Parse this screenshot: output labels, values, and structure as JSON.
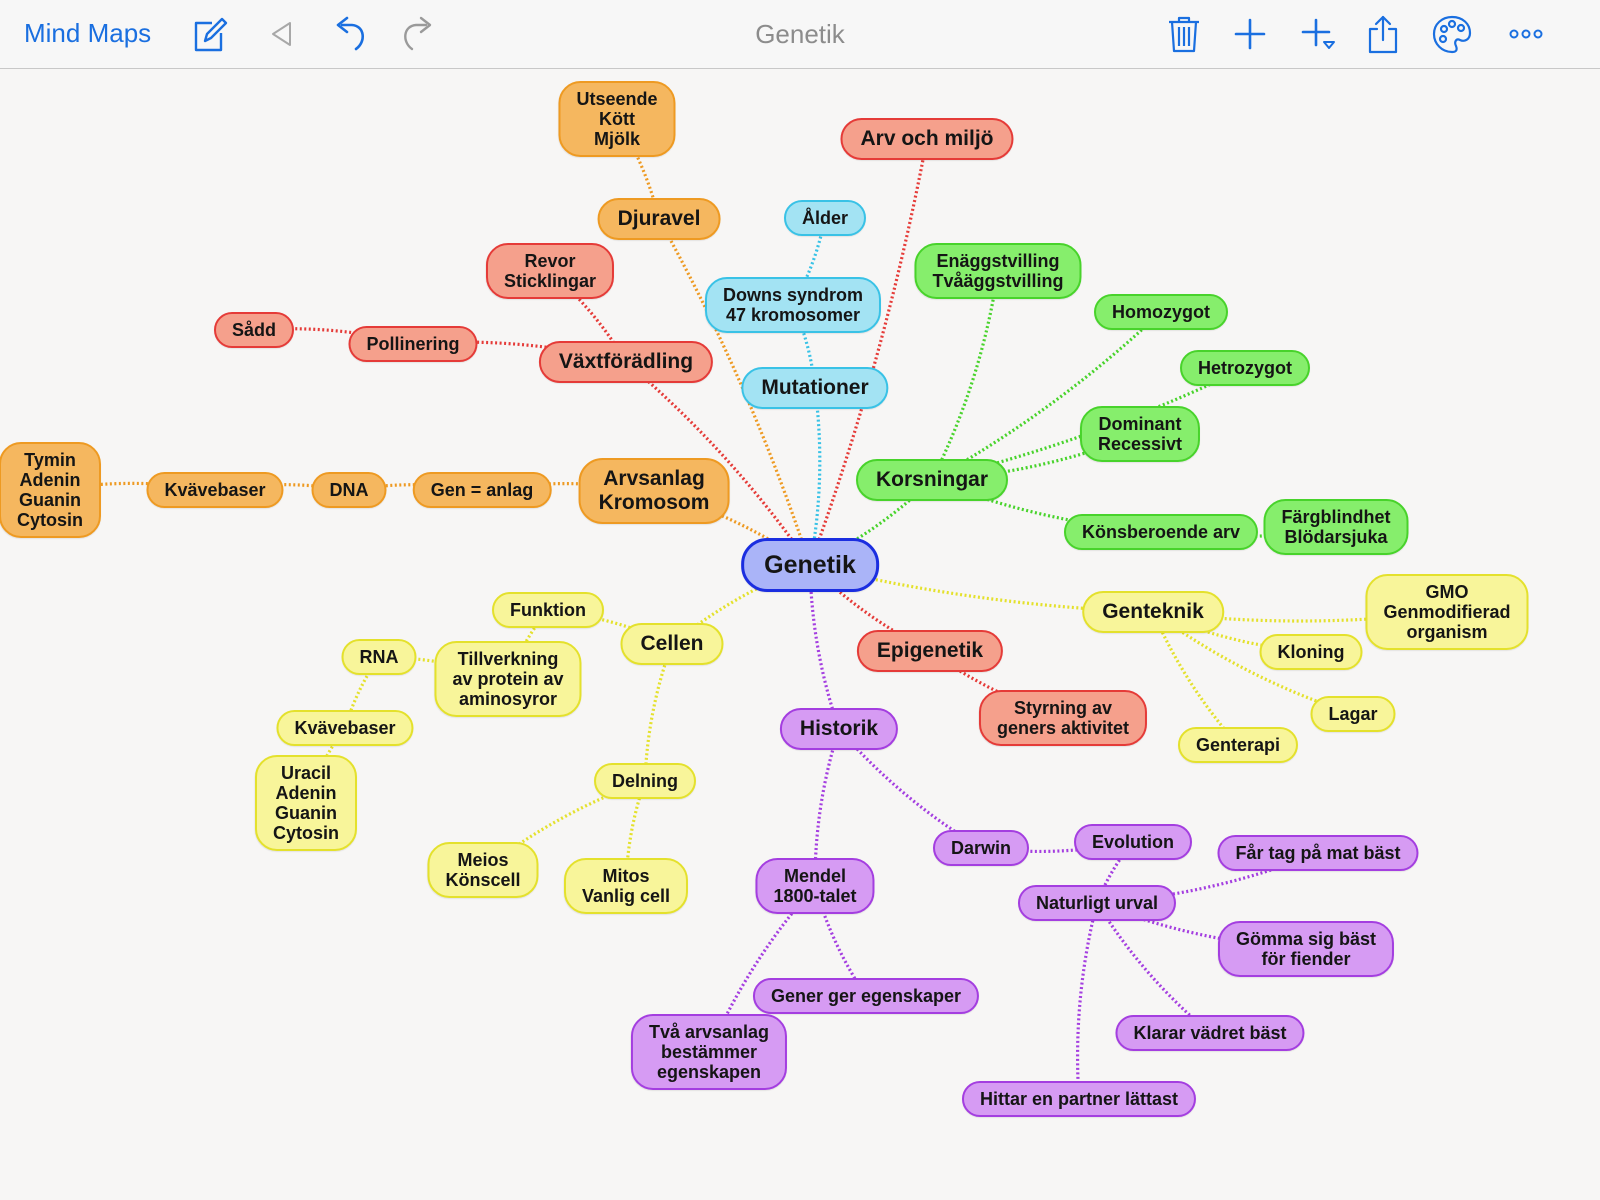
{
  "toolbar": {
    "app_title": "Mind Maps",
    "doc_title": "Genetik",
    "icons": [
      "edit-icon",
      "back-icon",
      "undo-icon",
      "redo-icon",
      "trash-icon",
      "add-icon",
      "add-child-icon",
      "share-icon",
      "palette-icon",
      "more-icon"
    ]
  },
  "colors": {
    "toolbar_blue": "#1a6fe0",
    "orange": "#f5b75f",
    "red": "#f5a08c",
    "cyan": "#a3e3f3",
    "green": "#86ee6c",
    "yellow": "#f8f59a",
    "purple": "#d69bf3",
    "root": "#aab4f8"
  },
  "nodes": [
    {
      "id": "genetik",
      "lines": [
        "Genetik"
      ],
      "color": "blue",
      "level": 0
    },
    {
      "id": "arvsanlag",
      "lines": [
        "Arvsanlag",
        "Kromosom"
      ],
      "color": "orange",
      "level": 1,
      "parent": "genetik"
    },
    {
      "id": "gen-anlag",
      "lines": [
        "Gen = anlag"
      ],
      "color": "orange",
      "level": 2,
      "parent": "arvsanlag"
    },
    {
      "id": "dna",
      "lines": [
        "DNA"
      ],
      "color": "orange",
      "level": 2,
      "parent": "gen-anlag"
    },
    {
      "id": "kvavebaser-o",
      "lines": [
        "Kvävebaser"
      ],
      "color": "orange",
      "level": 2,
      "parent": "dna"
    },
    {
      "id": "tymin",
      "lines": [
        "Tymin",
        "Adenin",
        "Guanin",
        "Cytosin"
      ],
      "color": "orange",
      "level": 2,
      "parent": "kvavebaser-o"
    },
    {
      "id": "djuravel",
      "lines": [
        "Djuravel"
      ],
      "color": "orange",
      "level": 1,
      "parent": "genetik"
    },
    {
      "id": "utseende",
      "lines": [
        "Utseende",
        "Kött",
        "Mjölk"
      ],
      "color": "orange",
      "level": 2,
      "parent": "djuravel"
    },
    {
      "id": "vaxtforadling",
      "lines": [
        "Växtförädling"
      ],
      "color": "red",
      "level": 1,
      "parent": "genetik"
    },
    {
      "id": "revor",
      "lines": [
        "Revor",
        "Sticklingar"
      ],
      "color": "red",
      "level": 2,
      "parent": "vaxtforadling"
    },
    {
      "id": "pollinering",
      "lines": [
        "Pollinering"
      ],
      "color": "red",
      "level": 2,
      "parent": "vaxtforadling"
    },
    {
      "id": "sadd",
      "lines": [
        "Sådd"
      ],
      "color": "red",
      "level": 2,
      "parent": "pollinering"
    },
    {
      "id": "arv-miljo",
      "lines": [
        "Arv och miljö"
      ],
      "color": "red",
      "level": 1,
      "parent": "genetik"
    },
    {
      "id": "mutationer",
      "lines": [
        "Mutationer"
      ],
      "color": "cyan",
      "level": 1,
      "parent": "genetik"
    },
    {
      "id": "downs",
      "lines": [
        "Downs syndrom",
        "47 kromosomer"
      ],
      "color": "cyan",
      "level": 2,
      "parent": "mutationer"
    },
    {
      "id": "alder",
      "lines": [
        "Ålder"
      ],
      "color": "cyan",
      "level": 2,
      "parent": "downs"
    },
    {
      "id": "korsningar",
      "lines": [
        "Korsningar"
      ],
      "color": "green",
      "level": 1,
      "parent": "genetik"
    },
    {
      "id": "enaggs",
      "lines": [
        "Enäggstvilling",
        "Tvåäggstvilling"
      ],
      "color": "green",
      "level": 2,
      "parent": "korsningar"
    },
    {
      "id": "homozygot",
      "lines": [
        "Homozygot"
      ],
      "color": "green",
      "level": 2,
      "parent": "korsningar"
    },
    {
      "id": "hetrozygot",
      "lines": [
        "Hetrozygot"
      ],
      "color": "green",
      "level": 2,
      "parent": "korsningar"
    },
    {
      "id": "dominant",
      "lines": [
        "Dominant",
        "Recessivt"
      ],
      "color": "green",
      "level": 2,
      "parent": "korsningar"
    },
    {
      "id": "konsberoende",
      "lines": [
        "Könsberoende arv"
      ],
      "color": "green",
      "level": 2,
      "parent": "korsningar"
    },
    {
      "id": "fargblindhet",
      "lines": [
        "Färgblindhet",
        "Blödarsjuka"
      ],
      "color": "green",
      "level": 2,
      "parent": "konsberoende"
    },
    {
      "id": "genteknik",
      "lines": [
        "Genteknik"
      ],
      "color": "yellow",
      "level": 1,
      "parent": "genetik"
    },
    {
      "id": "gmo",
      "lines": [
        "GMO",
        "Genmodifierad",
        "organism"
      ],
      "color": "yellow",
      "level": 2,
      "parent": "genteknik"
    },
    {
      "id": "kloning",
      "lines": [
        "Kloning"
      ],
      "color": "yellow",
      "level": 2,
      "parent": "genteknik"
    },
    {
      "id": "lagar",
      "lines": [
        "Lagar"
      ],
      "color": "yellow",
      "level": 2,
      "parent": "genteknik"
    },
    {
      "id": "genterapi",
      "lines": [
        "Genterapi"
      ],
      "color": "yellow",
      "level": 2,
      "parent": "genteknik"
    },
    {
      "id": "epigenetik",
      "lines": [
        "Epigenetik"
      ],
      "color": "red",
      "level": 1,
      "parent": "genetik"
    },
    {
      "id": "styrning",
      "lines": [
        "Styrning av",
        "geners aktivitet"
      ],
      "color": "red",
      "level": 2,
      "parent": "epigenetik"
    },
    {
      "id": "cellen",
      "lines": [
        "Cellen"
      ],
      "color": "yellow",
      "level": 1,
      "parent": "genetik"
    },
    {
      "id": "funktion",
      "lines": [
        "Funktion"
      ],
      "color": "yellow",
      "level": 2,
      "parent": "cellen"
    },
    {
      "id": "tillverkning",
      "lines": [
        "Tillverkning",
        "av protein av",
        "aminosyror"
      ],
      "color": "yellow",
      "level": 2,
      "parent": "funktion"
    },
    {
      "id": "rna",
      "lines": [
        "RNA"
      ],
      "color": "yellow",
      "level": 2,
      "parent": "tillverkning"
    },
    {
      "id": "kvavebaser-y",
      "lines": [
        "Kvävebaser"
      ],
      "color": "yellow",
      "level": 2,
      "parent": "rna"
    },
    {
      "id": "uracil",
      "lines": [
        "Uracil",
        "Adenin",
        "Guanin",
        "Cytosin"
      ],
      "color": "yellow",
      "level": 2,
      "parent": "kvavebaser-y"
    },
    {
      "id": "delning",
      "lines": [
        "Delning"
      ],
      "color": "yellow",
      "level": 2,
      "parent": "cellen"
    },
    {
      "id": "meios",
      "lines": [
        "Meios",
        "Könscell"
      ],
      "color": "yellow",
      "level": 2,
      "parent": "delning"
    },
    {
      "id": "mitos",
      "lines": [
        "Mitos",
        "Vanlig cell"
      ],
      "color": "yellow",
      "level": 2,
      "parent": "delning"
    },
    {
      "id": "historik",
      "lines": [
        "Historik"
      ],
      "color": "purple",
      "level": 1,
      "parent": "genetik"
    },
    {
      "id": "mendel",
      "lines": [
        "Mendel",
        "1800-talet"
      ],
      "color": "purple",
      "level": 2,
      "parent": "historik"
    },
    {
      "id": "gener-ger",
      "lines": [
        "Gener ger egenskaper"
      ],
      "color": "purple",
      "level": 2,
      "parent": "mendel"
    },
    {
      "id": "tva-arvsanlag",
      "lines": [
        "Två arvsanlag",
        "bestämmer",
        "egenskapen"
      ],
      "color": "purple",
      "level": 2,
      "parent": "mendel"
    },
    {
      "id": "darwin",
      "lines": [
        "Darwin"
      ],
      "color": "purple",
      "level": 2,
      "parent": "historik"
    },
    {
      "id": "evolution",
      "lines": [
        "Evolution"
      ],
      "color": "purple",
      "level": 2,
      "parent": "darwin"
    },
    {
      "id": "naturligt-urval",
      "lines": [
        "Naturligt urval"
      ],
      "color": "purple",
      "level": 2,
      "parent": "evolution"
    },
    {
      "id": "far-tag",
      "lines": [
        "Får tag på mat bäst"
      ],
      "color": "purple",
      "level": 2,
      "parent": "naturligt-urval"
    },
    {
      "id": "gomma",
      "lines": [
        "Gömma sig bäst",
        "för fiender"
      ],
      "color": "purple",
      "level": 2,
      "parent": "naturligt-urval"
    },
    {
      "id": "klarar",
      "lines": [
        "Klarar vädret bäst"
      ],
      "color": "purple",
      "level": 2,
      "parent": "naturligt-urval"
    },
    {
      "id": "hittar",
      "lines": [
        "Hittar en partner lättast"
      ],
      "color": "purple",
      "level": 2,
      "parent": "naturligt-urval"
    }
  ]
}
